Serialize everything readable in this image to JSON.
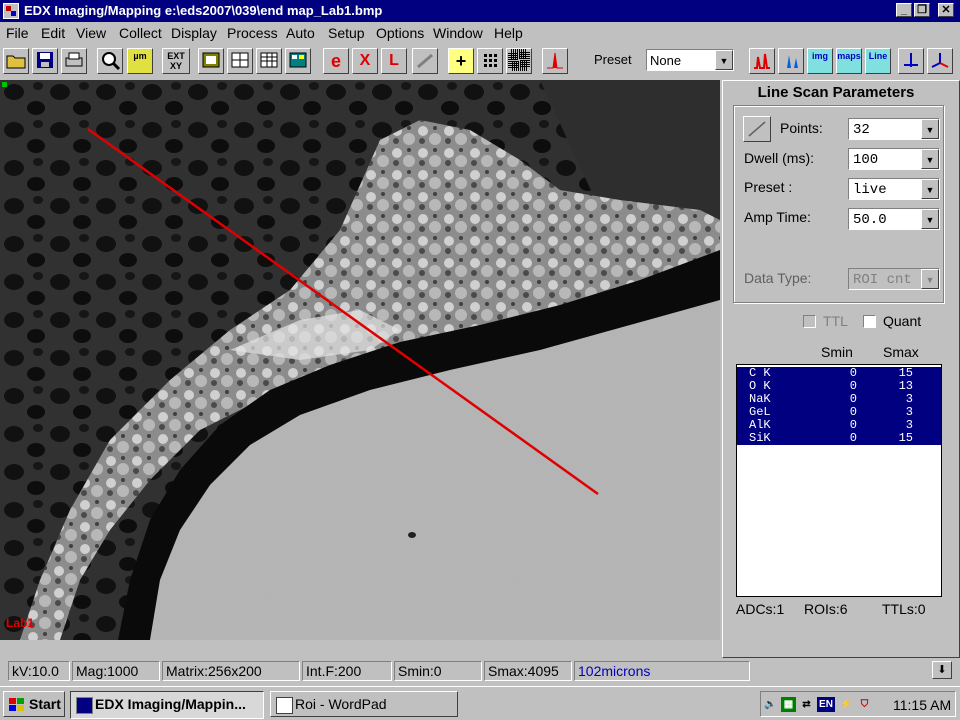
{
  "window": {
    "title": "EDX Imaging/Mapping e:\\eds2007\\039\\end map_Lab1.bmp",
    "minimize": "_",
    "restore": "❐",
    "close": "✕"
  },
  "menu": [
    "File",
    "Edit",
    "View",
    "Collect",
    "Display",
    "Process",
    "Auto",
    "Setup",
    "Options",
    "Window",
    "Help"
  ],
  "toolbar": {
    "ext_label": "EXT XY",
    "um_label": "µm",
    "e_label": "e",
    "x_label": "X",
    "l_label": "L",
    "plus_label": "+",
    "img_label": "img",
    "maps_label": "maps",
    "line_label": "Line",
    "preset_label": "Preset",
    "preset_value": "None"
  },
  "image": {
    "label": "Lab1",
    "scan_line_color": "#e00000"
  },
  "panel": {
    "title": "Line Scan Parameters",
    "points_label": "Points:",
    "points_value": "32",
    "dwell_label": "Dwell (ms):",
    "dwell_value": "100",
    "preset_label": "Preset :",
    "preset_value": "live",
    "amp_label": "Amp Time:",
    "amp_value": "50.0",
    "datatype_label": "Data Type:",
    "datatype_value": "ROI cnt",
    "ttl_label": "TTL",
    "quant_label": "Quant",
    "smin_header": "Smin",
    "smax_header": "Smax",
    "elements": [
      {
        "name": "C K",
        "smin": "0",
        "smax": "15"
      },
      {
        "name": "O K",
        "smin": "0",
        "smax": "13"
      },
      {
        "name": "NaK",
        "smin": "0",
        "smax": "3"
      },
      {
        "name": "GeL",
        "smin": "0",
        "smax": "3"
      },
      {
        "name": "AlK",
        "smin": "0",
        "smax": "3"
      },
      {
        "name": "SiK",
        "smin": "0",
        "smax": "15"
      }
    ],
    "adcs": "ADCs:1",
    "rois": "ROIs:6",
    "ttls": "TTLs:0"
  },
  "status": {
    "kv": "kV:10.0",
    "mag": "Mag:1000",
    "matrix": "Matrix:256x200",
    "intf": "Int.F:200",
    "smin": "Smin:0",
    "smax": "Smax:4095",
    "scale": "102microns"
  },
  "taskbar": {
    "start": "Start",
    "task1": "EDX Imaging/Mappin...",
    "task2": "Roi - WordPad",
    "lang": "EN",
    "clock": "11:15 AM"
  }
}
